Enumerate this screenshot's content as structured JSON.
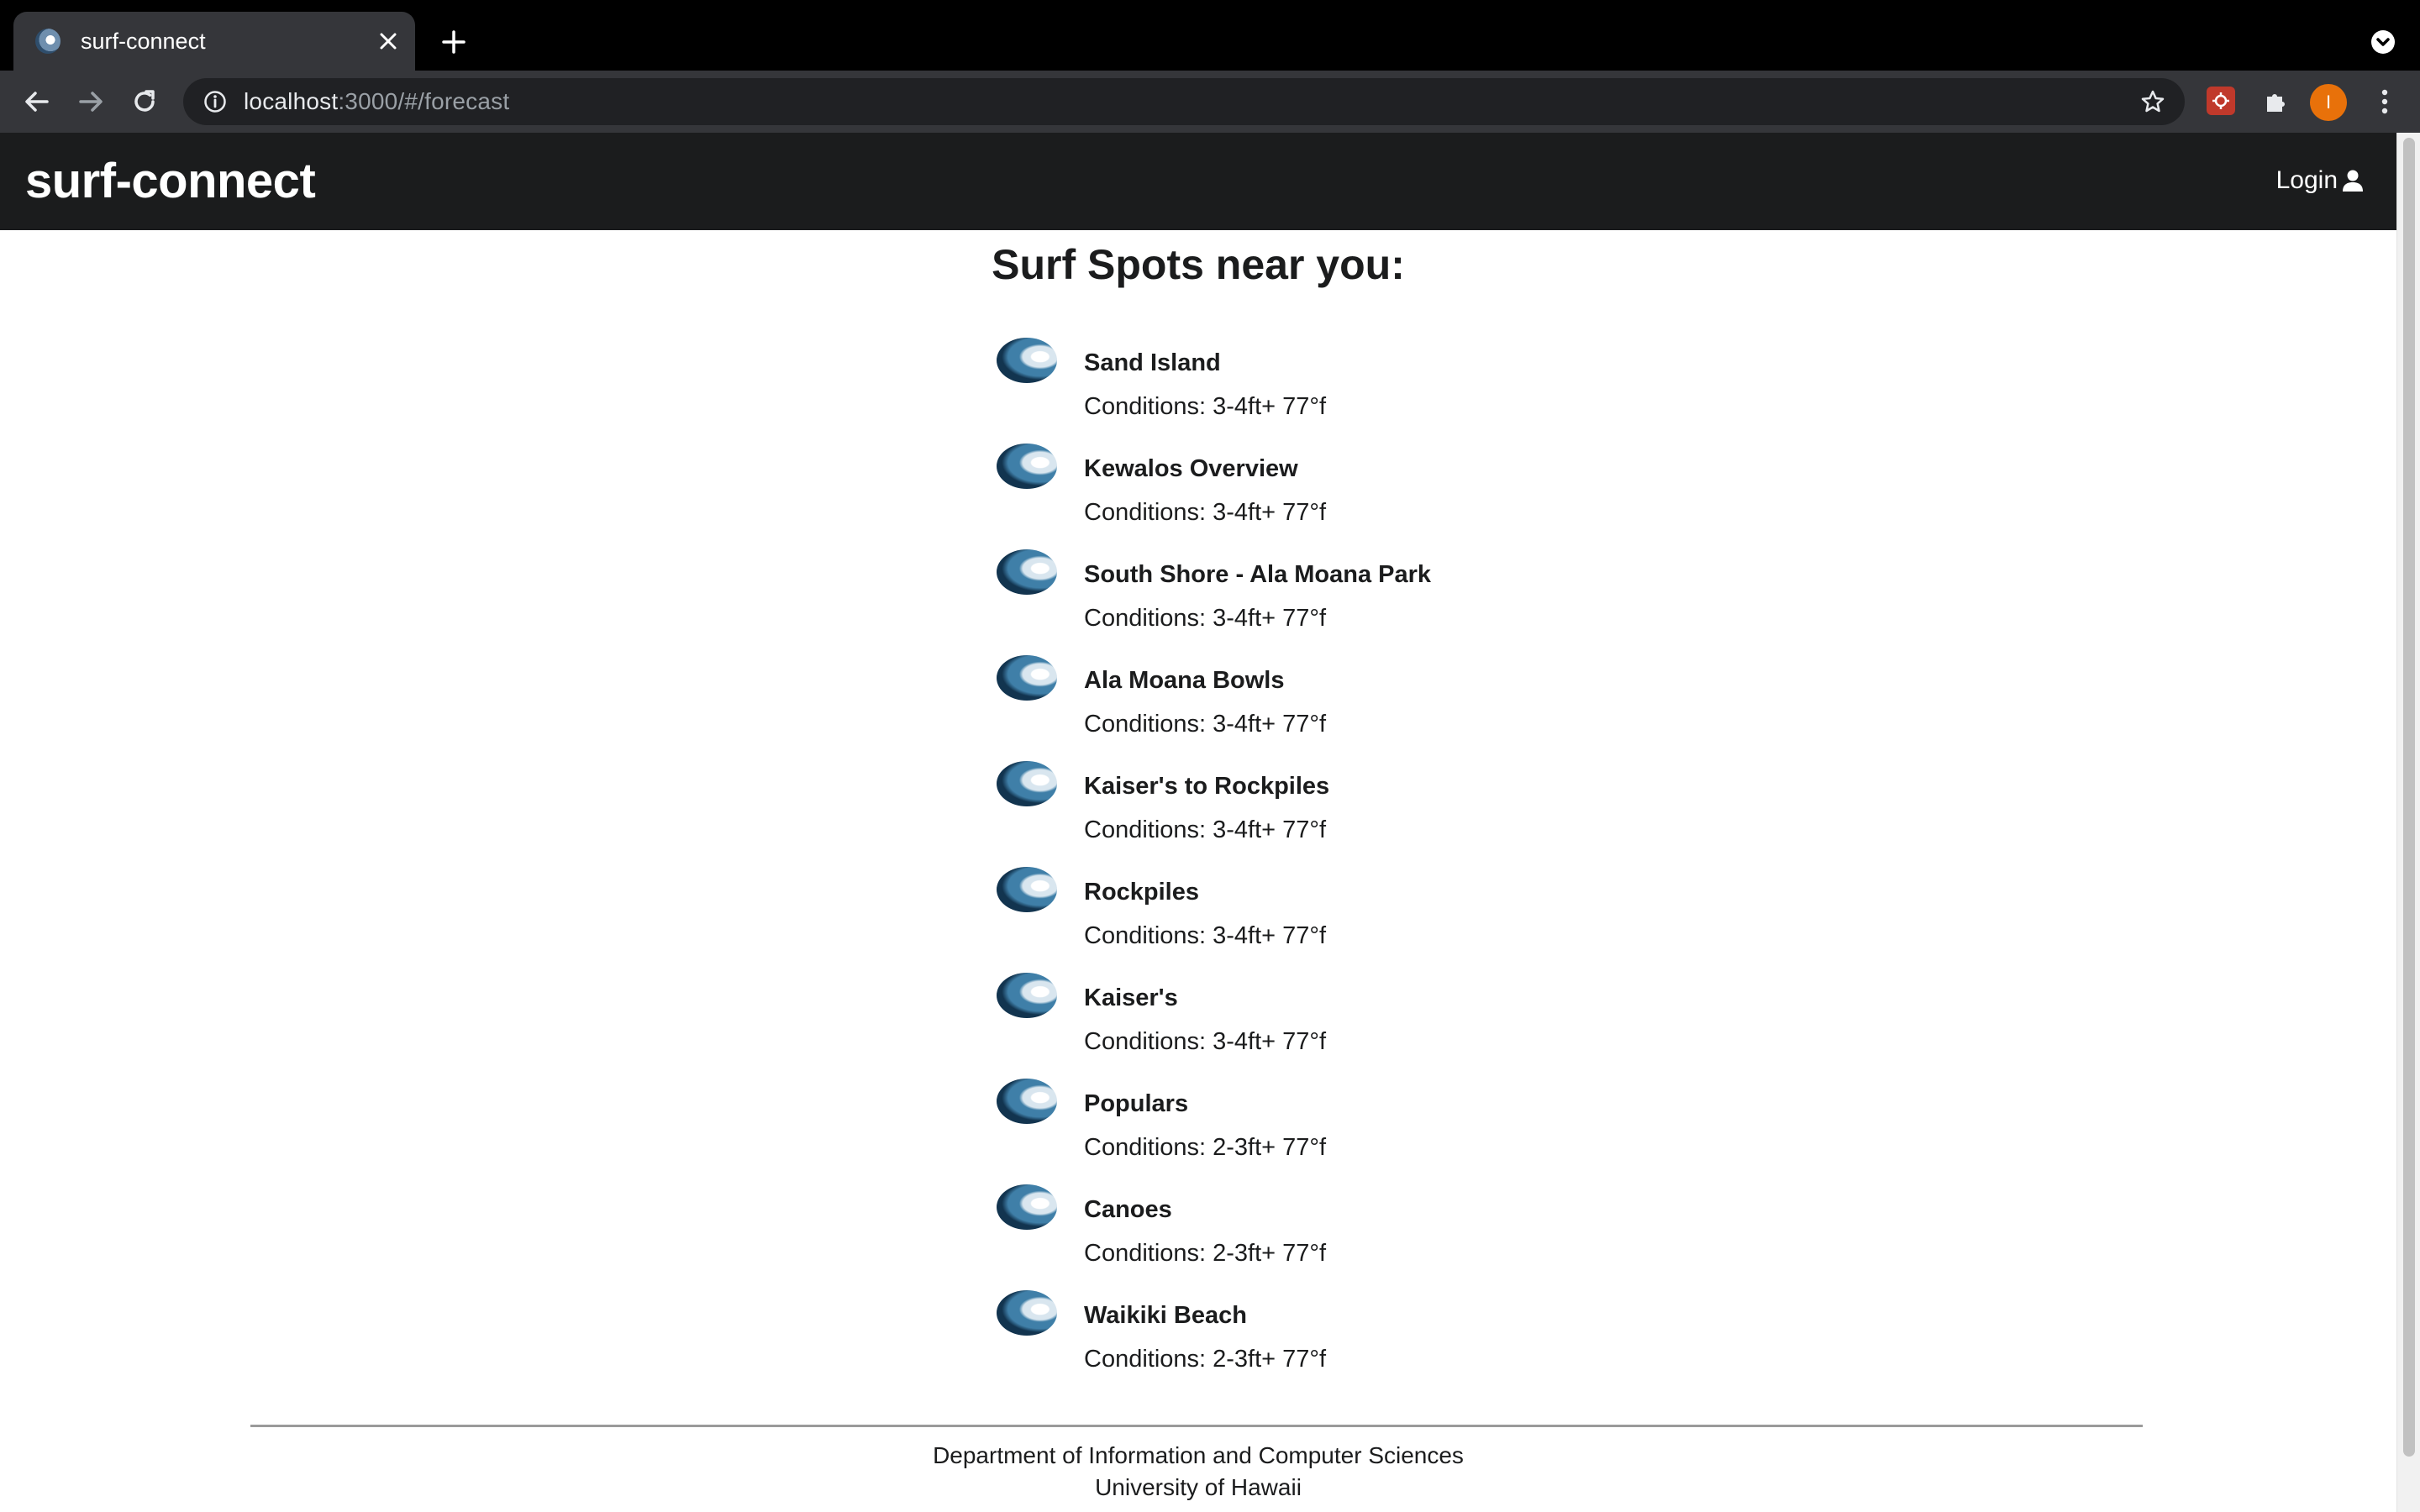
{
  "browser": {
    "tab_title": "surf-connect",
    "url_host": "localhost",
    "url_rest": ":3000/#/forecast",
    "profile_initial": "I"
  },
  "navbar": {
    "brand": "surf-connect",
    "login_label": "Login"
  },
  "main": {
    "title": "Surf Spots near you:",
    "spots": [
      {
        "name": "Sand Island",
        "conditions": "Conditions: 3-4ft+ 77°f"
      },
      {
        "name": "Kewalos Overview",
        "conditions": "Conditions: 3-4ft+ 77°f"
      },
      {
        "name": "South Shore - Ala Moana Park",
        "conditions": "Conditions: 3-4ft+ 77°f"
      },
      {
        "name": "Ala Moana Bowls",
        "conditions": "Conditions: 3-4ft+ 77°f"
      },
      {
        "name": "Kaiser's to Rockpiles",
        "conditions": "Conditions: 3-4ft+ 77°f"
      },
      {
        "name": "Rockpiles",
        "conditions": "Conditions: 3-4ft+ 77°f"
      },
      {
        "name": "Kaiser's",
        "conditions": "Conditions: 3-4ft+ 77°f"
      },
      {
        "name": "Populars",
        "conditions": "Conditions: 2-3ft+ 77°f"
      },
      {
        "name": "Canoes",
        "conditions": "Conditions: 2-3ft+ 77°f"
      },
      {
        "name": "Waikiki Beach",
        "conditions": "Conditions: 2-3ft+ 77°f"
      }
    ]
  },
  "footer": {
    "line1": "Department of Information and Computer Sciences",
    "line2": "University of Hawaii"
  }
}
